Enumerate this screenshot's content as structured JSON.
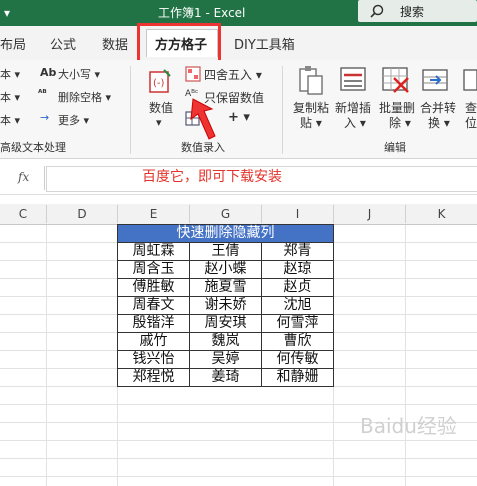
{
  "window": {
    "title": "工作簿1  -  Excel",
    "search_label": "搜索"
  },
  "tabs": [
    {
      "label": "布局"
    },
    {
      "label": "公式"
    },
    {
      "label": "数据"
    },
    {
      "label": "方方格子"
    },
    {
      "label": "DIY工具箱"
    }
  ],
  "ribbon": {
    "group_left": {
      "items": [
        "本 ▾",
        "本 ▾",
        "本 ▾"
      ],
      "size_label": "大小写 ▾",
      "delete_space_label": "删除空格 ▾",
      "more_label": "更多 ▾",
      "group_label": "高级文本处理"
    },
    "group_numbers": {
      "numeric_label": "数值",
      "rounding_label": "四舍五入 ▾",
      "keep_numeric_label": "只保留数值",
      "group_label": "数值录入",
      "plus_label": "+ ▾"
    },
    "group_edit": {
      "copy_paste_label_1": "复制粘",
      "copy_paste_label_2": "贴 ▾",
      "insert_label_1": "新增插",
      "insert_label_2": "入 ▾",
      "batch_delete_label_1": "批量删",
      "batch_delete_label_2": "除 ▾",
      "merge_label_1": "合并转",
      "merge_label_2": "换 ▾",
      "extra_label_1": "查",
      "extra_label_2": "位",
      "group_label": "编辑"
    }
  },
  "formula_bar": {
    "fx_label": "fx",
    "note": "百度它，即可下载安装"
  },
  "columns": [
    "C",
    "D",
    "E",
    "G",
    "I",
    "J",
    "K"
  ],
  "table": {
    "header": "快速删除隐藏列",
    "rows": [
      [
        "周虹霖",
        "王倩",
        "郑青"
      ],
      [
        "周含玉",
        "赵小蝶",
        "赵琼"
      ],
      [
        "傅胜敏",
        "施夏雪",
        "赵贞"
      ],
      [
        "周春文",
        "谢未娇",
        "沈旭"
      ],
      [
        "殷锴洋",
        "周安琪",
        "何雪萍"
      ],
      [
        "戚竹",
        "魏岚",
        "曹欣"
      ],
      [
        "钱兴怡",
        "吴婷",
        "何传敏"
      ],
      [
        "郑程悦",
        "姜琦",
        "和静姗"
      ]
    ]
  },
  "watermark": "Baidu经验",
  "colors": {
    "excel_green": "#217346",
    "table_header": "#4472c4",
    "highlight_red": "#e33333"
  }
}
